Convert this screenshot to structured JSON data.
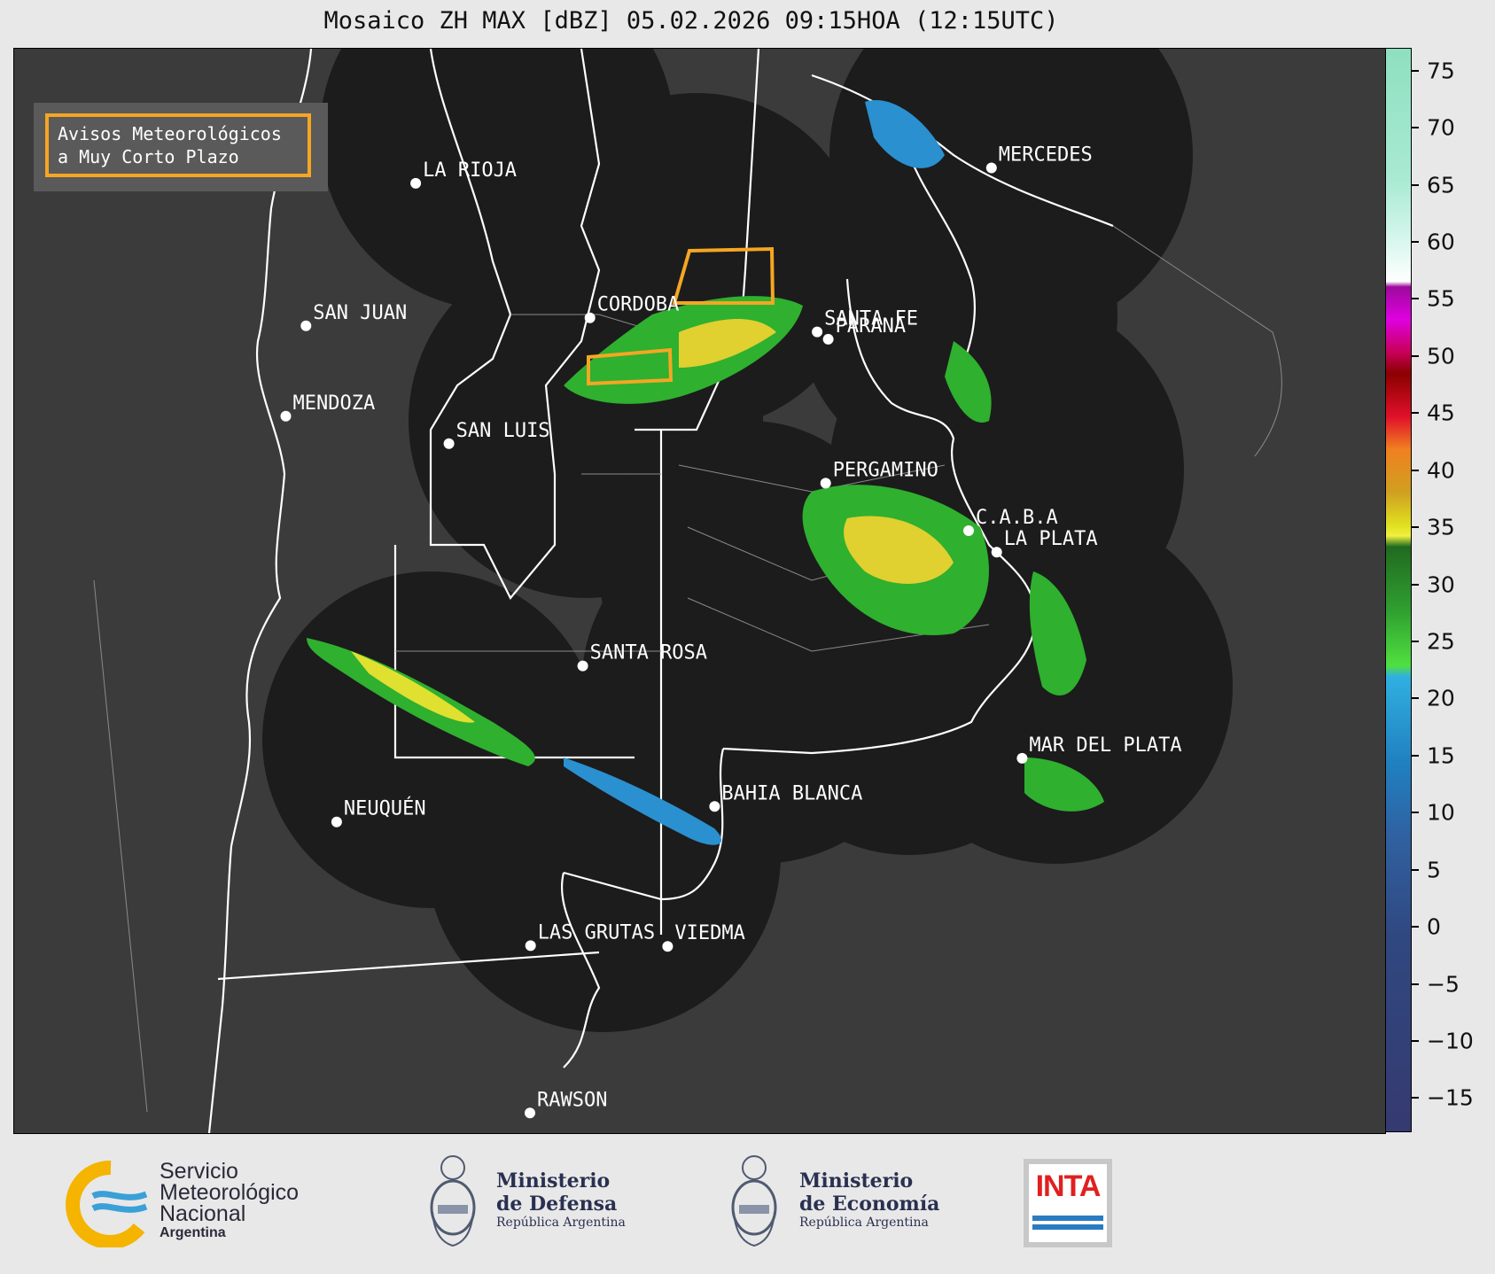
{
  "title": "Mosaico ZH MAX [dBZ] 05.02.2026 09:15HOA (12:15UTC)",
  "legend_box": {
    "line1": "Avisos Meteorológicos",
    "line2": "a Muy Corto Plazo",
    "border_color": "#f5a623"
  },
  "cities": [
    {
      "name": "LA RIOJA",
      "lon": -66.85,
      "lat": -29.41
    },
    {
      "name": "CORDOBA",
      "lon": -64.18,
      "lat": -31.42
    },
    {
      "name": "SAN JUAN",
      "lon": -68.53,
      "lat": -31.54
    },
    {
      "name": "SANTA FE",
      "lon": -60.7,
      "lat": -31.63
    },
    {
      "name": "PARANA",
      "lon": -60.53,
      "lat": -31.74
    },
    {
      "name": "MENDOZA",
      "lon": -68.84,
      "lat": -32.89
    },
    {
      "name": "SAN LUIS",
      "lon": -66.34,
      "lat": -33.3
    },
    {
      "name": "PERGAMINO",
      "lon": -60.57,
      "lat": -33.89
    },
    {
      "name": "C.A.B.A",
      "lon": -58.38,
      "lat": -34.6
    },
    {
      "name": "LA PLATA",
      "lon": -57.95,
      "lat": -34.92
    },
    {
      "name": "MERCEDES",
      "lon": -58.03,
      "lat": -29.18
    },
    {
      "name": "SANTA ROSA",
      "lon": -64.29,
      "lat": -36.62
    },
    {
      "name": "MAR DEL PLATA",
      "lon": -57.56,
      "lat": -38.0
    },
    {
      "name": "BAHIA BLANCA",
      "lon": -62.27,
      "lat": -38.72
    },
    {
      "name": "NEUQUÉN",
      "lon": -68.06,
      "lat": -38.95
    },
    {
      "name": "LAS GRUTAS",
      "lon": -65.09,
      "lat": -40.8
    },
    {
      "name": "VIEDMA",
      "lon": -62.99,
      "lat": -40.81
    },
    {
      "name": "RAWSON",
      "lon": -65.1,
      "lat": -43.3
    }
  ],
  "colorbar": {
    "unit": "dBZ",
    "ticks": [
      "75",
      "70",
      "65",
      "60",
      "55",
      "50",
      "45",
      "40",
      "35",
      "30",
      "25",
      "20",
      "15",
      "10",
      "5",
      "0",
      "−5",
      "−10",
      "−15"
    ],
    "range": [
      -18,
      77
    ]
  },
  "footer": {
    "smn": {
      "line1": "Servicio",
      "line2": "Meteorológico",
      "line3": "Nacional",
      "line4": "Argentina"
    },
    "defensa": {
      "line1": "Ministerio",
      "line2": "de Defensa",
      "line3": "República Argentina"
    },
    "economia": {
      "line1": "Ministerio",
      "line2": "de Economía",
      "line3": "República Argentina"
    },
    "inta": {
      "label": "INTA"
    }
  },
  "colors": {
    "map_background": "#3d3d3d",
    "radar_coverage": "#1c1c1c",
    "boundaries": "#ffffff",
    "warning": "#f5a623"
  }
}
